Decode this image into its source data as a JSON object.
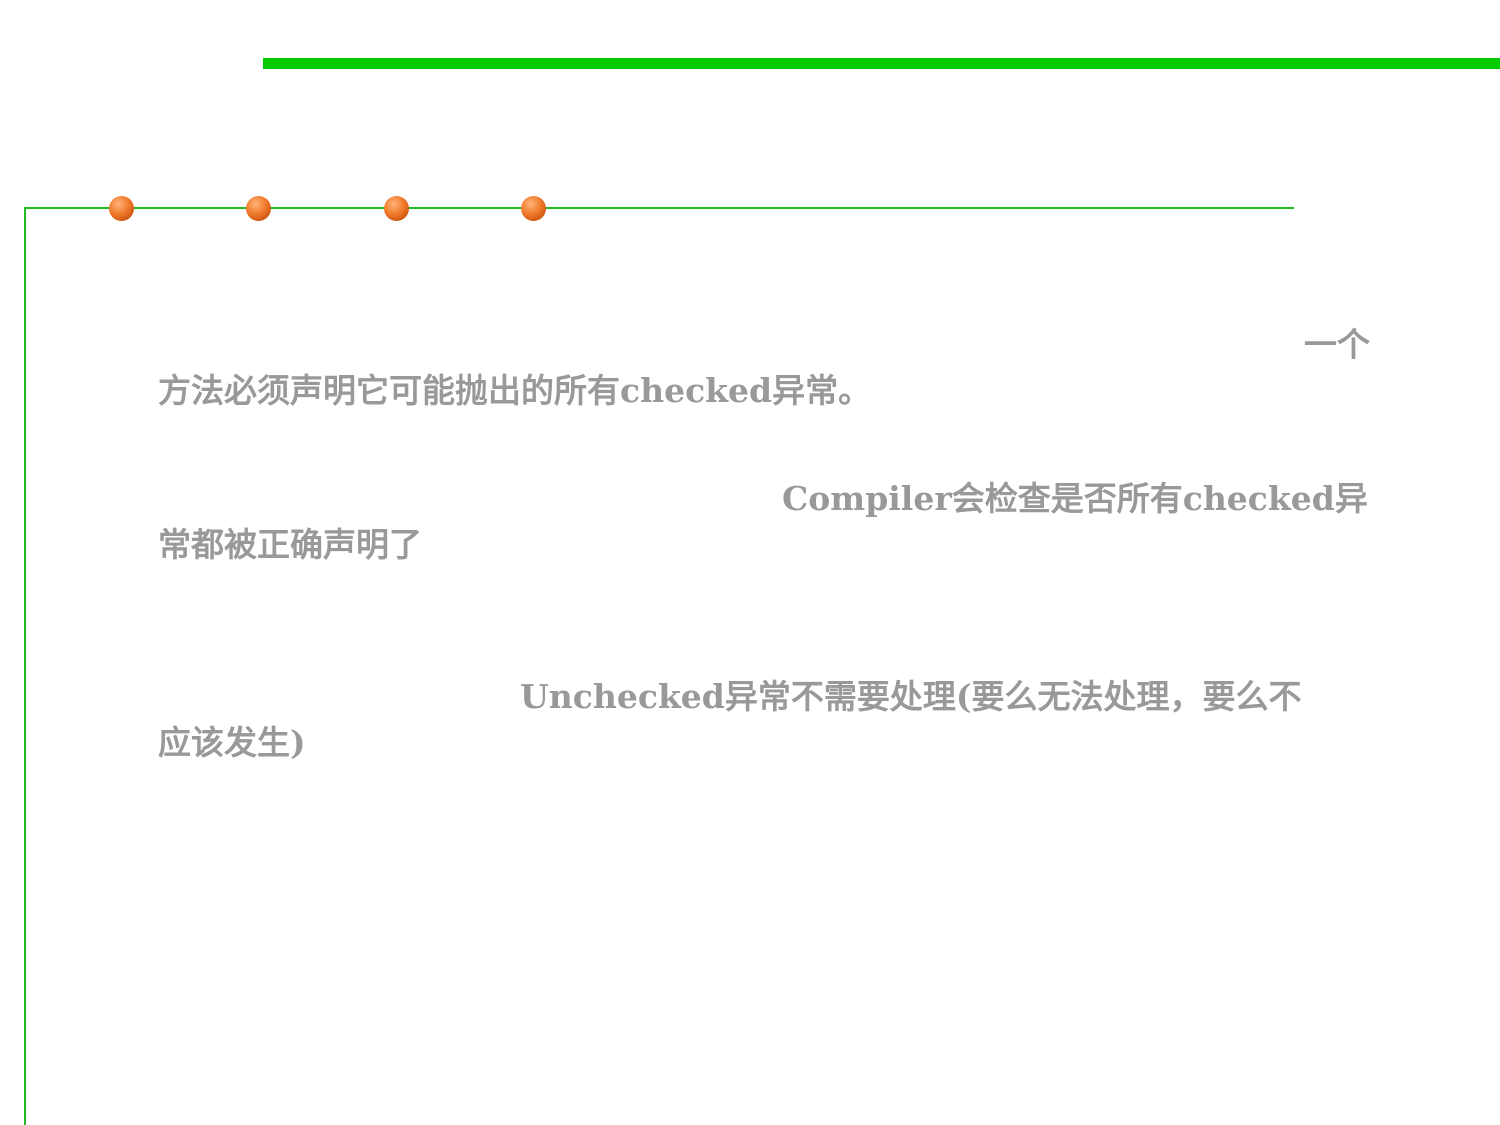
{
  "slide": {
    "paragraphs": [
      {
        "line1": "一个",
        "line2": "方法必须声明它可能抛出的所有checked异常。"
      },
      {
        "line1": "Compiler会检查是否所有checked异",
        "line2": "常都被正确声明了"
      },
      {
        "line1": "Unchecked异常不需要处理(要么无法处理，要么不",
        "line2": "应该发生)"
      }
    ]
  },
  "colors": {
    "accent_green": "#00cc00",
    "dot_orange": "#f07a2a",
    "text_gray": "#999999"
  }
}
